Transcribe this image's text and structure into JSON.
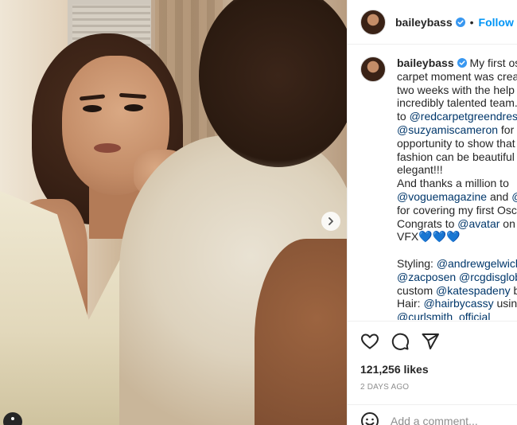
{
  "header": {
    "username": "baileybass",
    "separator": "•",
    "follow_label": "Follow",
    "verified_icon": "verified-badge-icon",
    "accent": "#0095f6"
  },
  "post": {
    "username": "baileybass",
    "caption_lines": [
      " My first osc",
      "carpet moment was creat",
      "two weeks with the help o",
      "incredibly talented team.",
      "to @redcarpetgreendress",
      "@suzyamiscameron for th",
      "opportunity to show that",
      "fashion can be beautiful a",
      "elegant!!!",
      "And thanks a million to",
      "@voguemagazine and @i",
      "for covering my first Osca",
      "Congrats to @avatar on t",
      "VFX💙💙💙",
      "",
      "Styling: @andrewgelwick",
      "@zacposen @rcgdisgloba",
      "custom @katespadeny ba",
      "Hair: @hairbycassy using",
      "@curlsmith_official"
    ],
    "mention_color": "#00376b"
  },
  "actions": {
    "like_icon": "heart-icon",
    "comment_icon": "comment-icon",
    "share_icon": "share-icon"
  },
  "likes": "121,256 likes",
  "time": "2 DAYS AGO",
  "add_comment": {
    "placeholder": "Add a comment..."
  },
  "carousel": {
    "next_icon": "chevron-right-icon"
  }
}
